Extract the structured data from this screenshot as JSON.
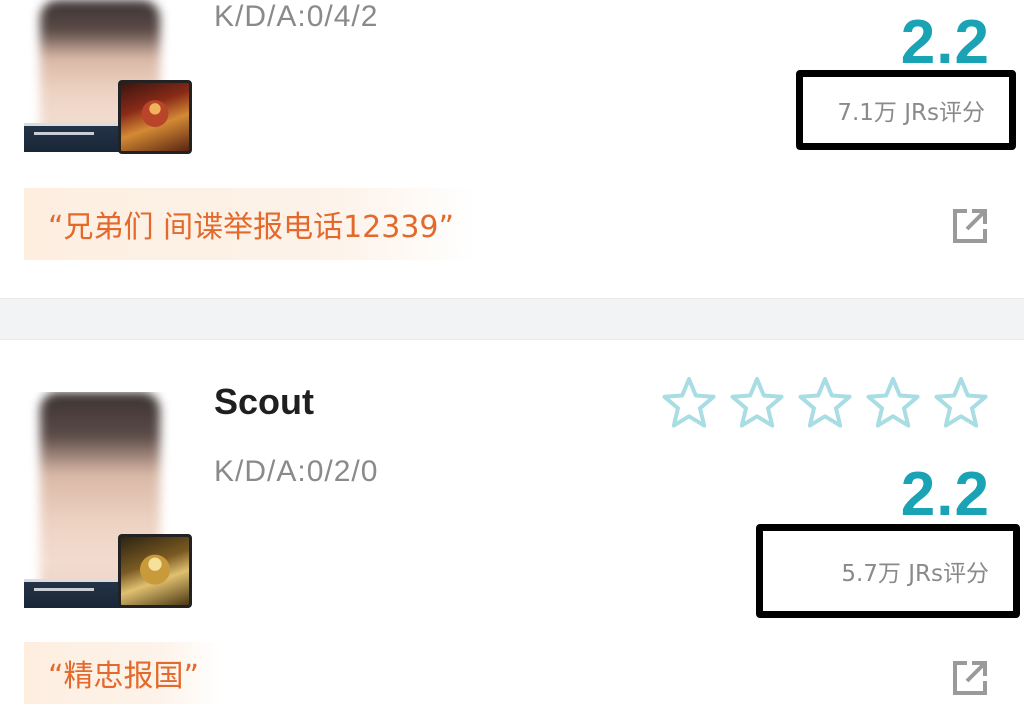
{
  "players": [
    {
      "name": "",
      "kda": "K/D/A:0/4/2",
      "score": "2.2",
      "rating_count": "7.1万 JRs评分",
      "quote": "“兄弟们 间谍举报电话12339”"
    },
    {
      "name": "Scout",
      "kda": "K/D/A:0/2/0",
      "score": "2.2",
      "rating_count": "5.7万 JRs评分",
      "quote": "“精忠报国”",
      "stars_filled": 0,
      "stars_total": 5
    }
  ],
  "colors": {
    "score": "#1aa3b5",
    "star_outline": "#a9dde4",
    "quote_text": "#e36a2c",
    "quote_bg": "#fdeee0",
    "highlight_box": "#000000"
  },
  "icons": {
    "share": "share-external-icon",
    "star": "star-outline-icon"
  }
}
